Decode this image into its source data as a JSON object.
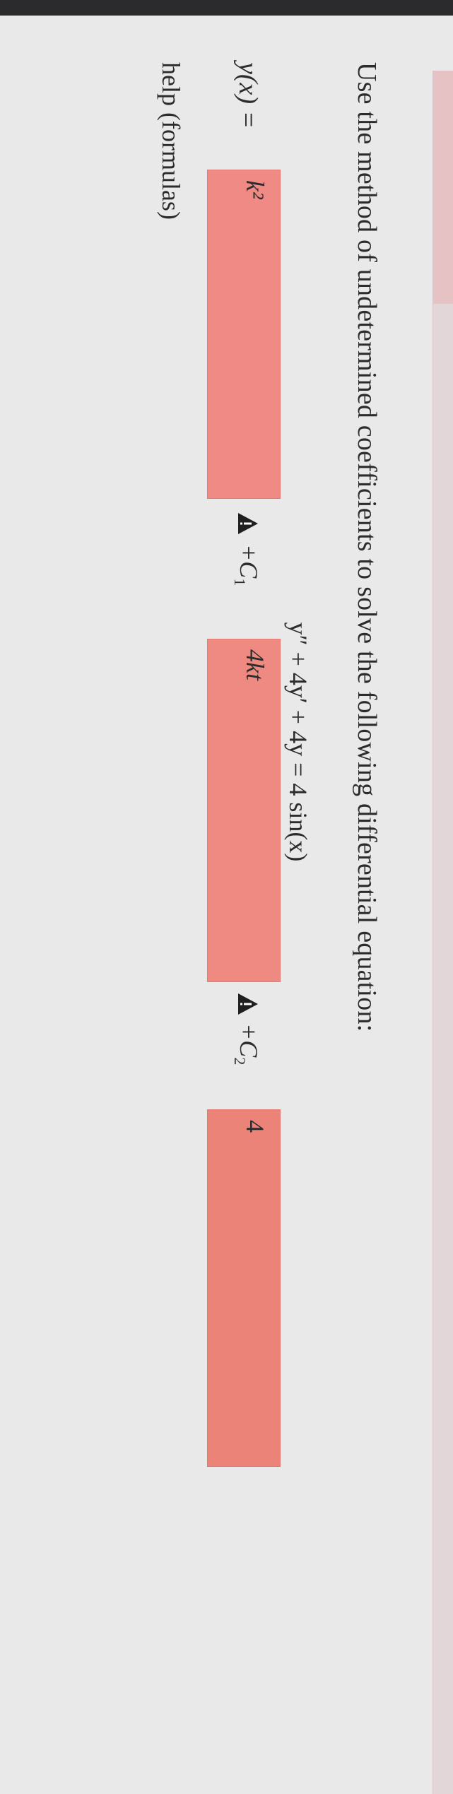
{
  "question": {
    "instruction": "Use the method of undetermined coefficients to solve the following differential equation:",
    "equation": "y″ + 4y′ + 4y = 4 sin(x)"
  },
  "answer": {
    "lhs": "y(x) =",
    "field1_value": "k²",
    "term1": "+C",
    "term1_subscript": "1",
    "field2_value": "4kt",
    "term2": "+C",
    "term2_subscript": "2",
    "field3_value": "4"
  },
  "help": {
    "label": "help (formulas)"
  },
  "colors": {
    "incorrect_field": "#ef8a82",
    "warning_icon": "#1f1f1f",
    "sidebar_accent": "#e7c2c4"
  },
  "icons": {
    "warning": "warning-triangle-icon"
  }
}
